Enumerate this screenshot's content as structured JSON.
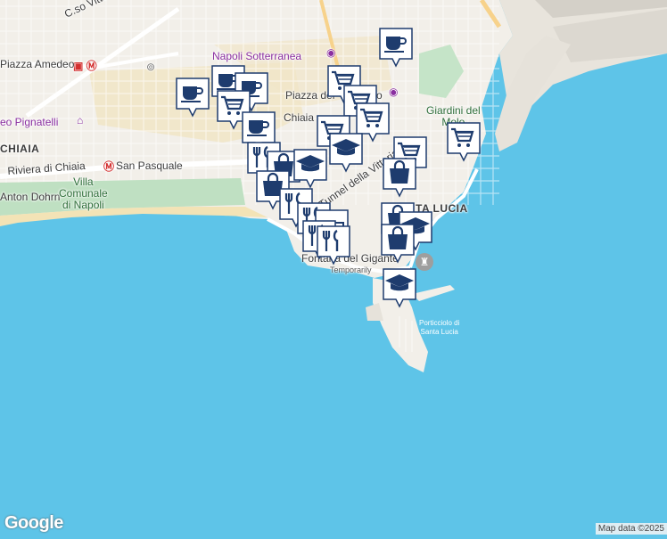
{
  "labels": {
    "corso": "C.so Vittorio Emanuele",
    "piazza_amedeo": "Piazza Amedeo",
    "napoli_sotterranea": "Napoli Sotterranea",
    "piazza_del": "Piazza del",
    "plebiscito_tail": "o",
    "chiaia_small": "Chiaia",
    "villa_pignatelli": "eo Pignatelli",
    "chiaia_district": "CHIAIA",
    "riviera": "Riviera di Chiaia",
    "san_pasquale": "San Pasquale",
    "anton_dohrn": "Anton Dohrn",
    "villa_comunale": "Villa\nComunale\ndi Napoli",
    "giardini": "Giardini del\nMolo",
    "tunnel": "Tunnel della Vittoria",
    "santa_lucia": "TA LUCIA",
    "fontana": "Fontana del Gigante",
    "temporarily": "Temporarily",
    "porticciolo": "Porticciolo di\nSanta Lucia"
  },
  "marker_icons": [
    "coffee-icon",
    "shopping-cart-icon",
    "graduation-cap-icon",
    "restaurant-icon",
    "shopping-bag-icon",
    "bed-icon"
  ],
  "colors": {
    "sea": "#5ec4e8",
    "land": "#f2efe9",
    "park": "#c8e6c9",
    "marker_fill": "#1e3c6e",
    "marker_bg": "#ffffff",
    "poi": "#8a2fa0",
    "metro": "#d32f2f"
  },
  "footer": {
    "logo": "Google",
    "attribution": "Map data ©2025"
  }
}
